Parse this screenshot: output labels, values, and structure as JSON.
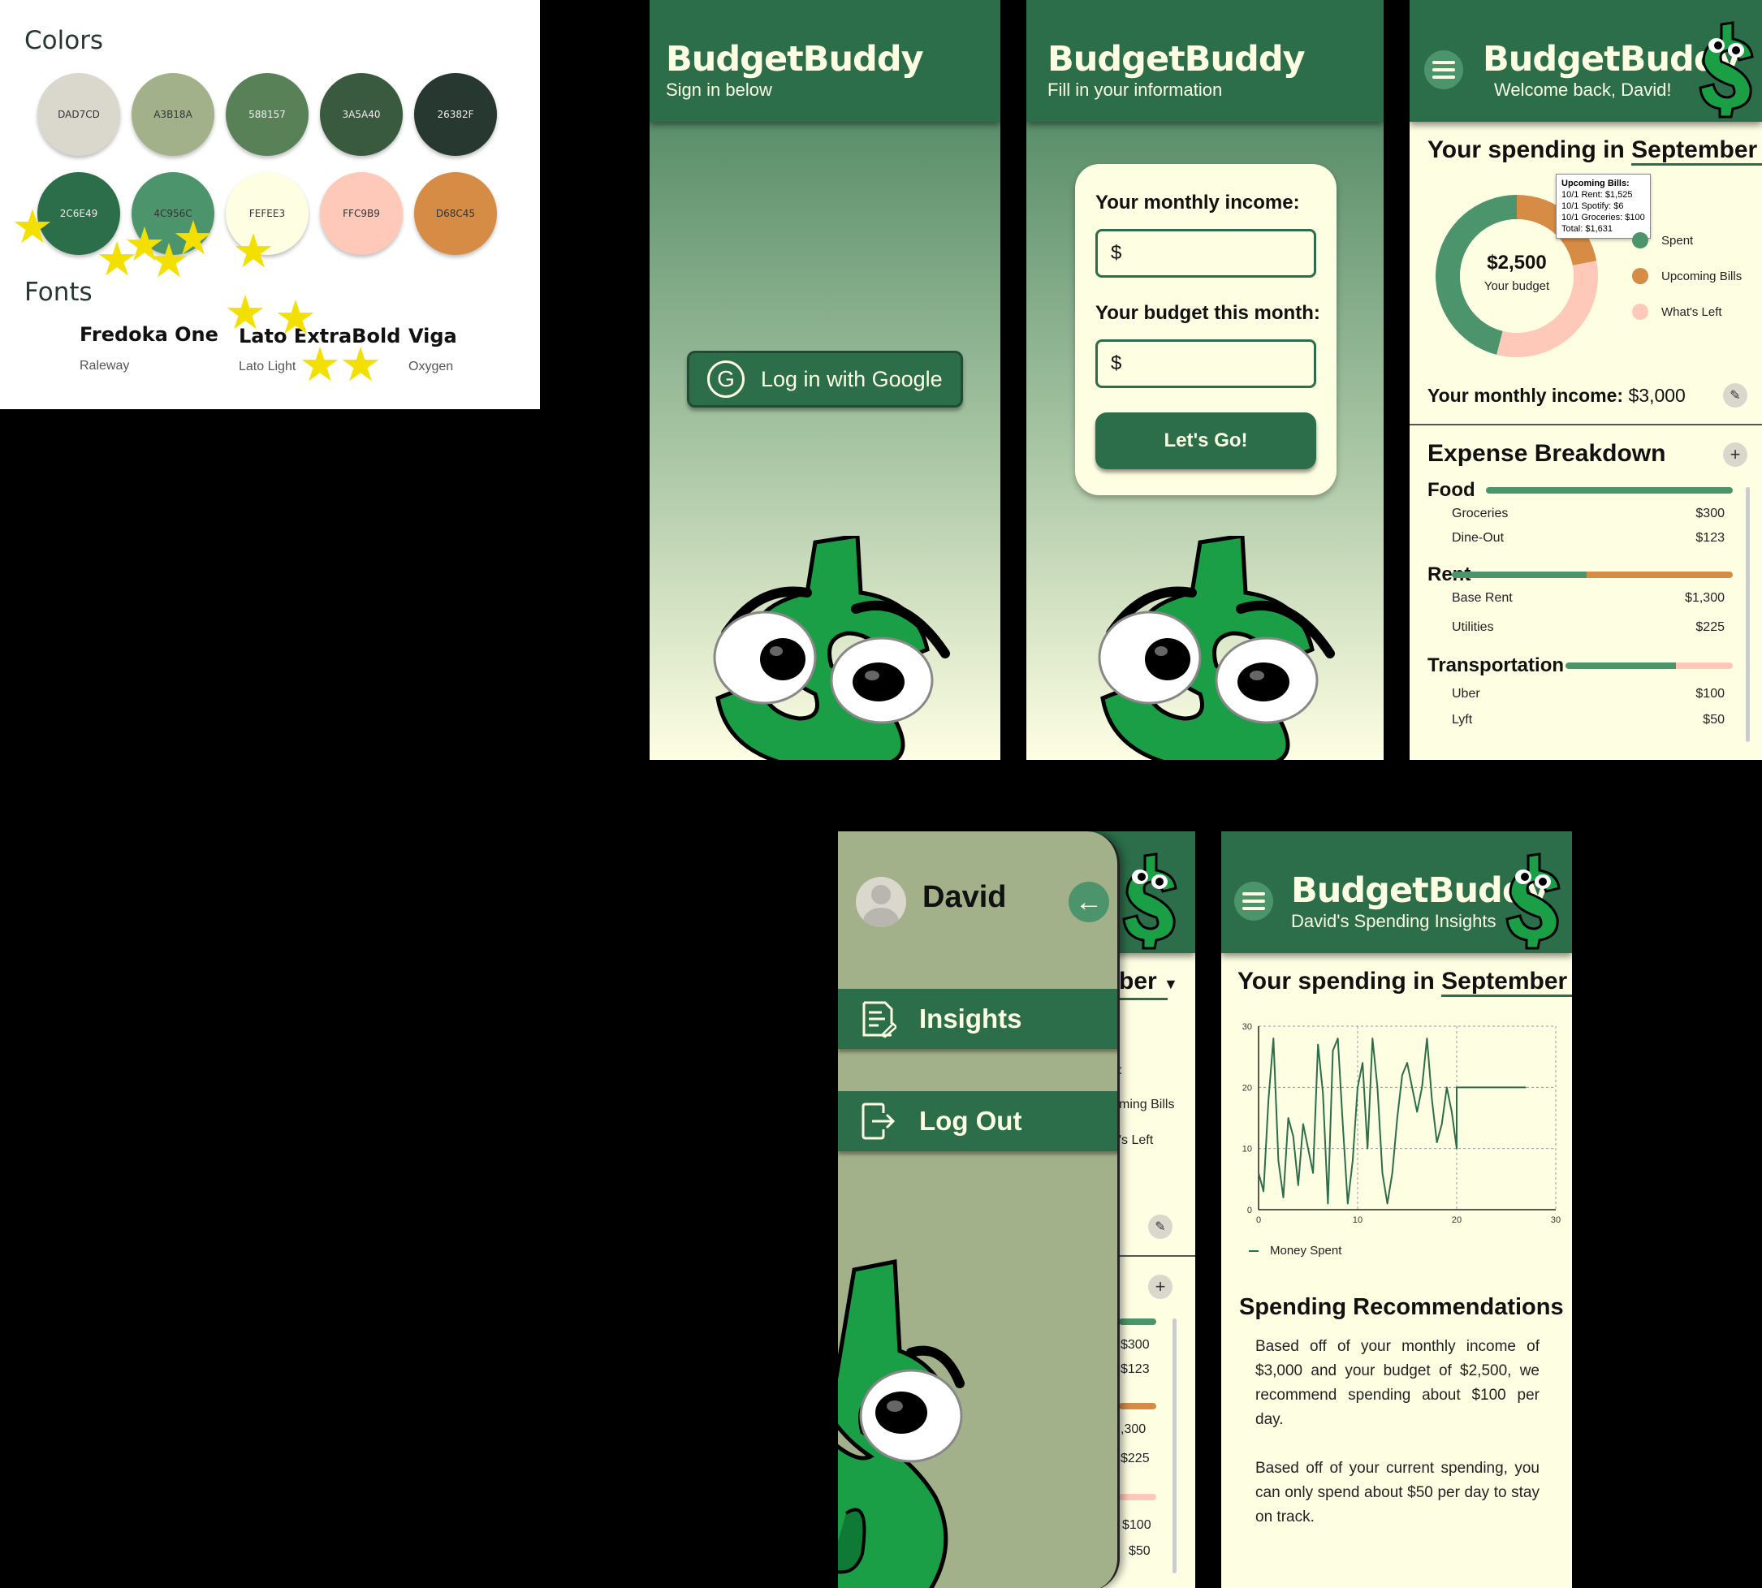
{
  "guide": {
    "colors_heading": "Colors",
    "fonts_heading": "Fonts",
    "swatches": [
      {
        "label": "DAD7CD",
        "hex": "#dad7cd"
      },
      {
        "label": "A3B18A",
        "hex": "#a3b18a"
      },
      {
        "label": "588157",
        "hex": "#588157"
      },
      {
        "label": "3A5A40",
        "hex": "#3a5a40"
      },
      {
        "label": "26382F",
        "hex": "#26382f"
      },
      {
        "label": "2C6E49",
        "hex": "#2c6e49"
      },
      {
        "label": "4C956C",
        "hex": "#4c956c"
      },
      {
        "label": "FEFEE3",
        "hex": "#fefee3"
      },
      {
        "label": "FFC9B9",
        "hex": "#ffc9b9"
      },
      {
        "label": "D68C45",
        "hex": "#d68c45"
      }
    ],
    "fonts": [
      {
        "name": "Fredoka One",
        "sub": "Raleway"
      },
      {
        "name": "Lato ExtraBold",
        "sub": "Lato Light"
      },
      {
        "name": "Viga",
        "sub": "Oxygen"
      }
    ]
  },
  "login": {
    "brand": "BudgetBuddy",
    "subtitle": "Sign in below",
    "google_button": "Log in with Google"
  },
  "info": {
    "brand": "BudgetBuddy",
    "subtitle": "Fill in your information",
    "income_label": "Your monthly income:",
    "income_value": "$",
    "budget_label": "Your budget this month:",
    "budget_value": "$",
    "go_button": "Let's Go!"
  },
  "dashboard": {
    "brand": "BudgetBuddy",
    "subtitle": "Welcome back, David!",
    "spending_prefix": "Your spending in",
    "month": "September",
    "budget_amount": "$2,500",
    "budget_label": "Your budget",
    "tooltip": {
      "title": "Upcoming Bills:",
      "lines": [
        "10/1 Rent: $1,525",
        "10/1 Spotify: $6",
        "10/1 Groceries: $100",
        "Total: $1,631"
      ]
    },
    "legend": [
      {
        "label": "Spent",
        "color": "#4c956c"
      },
      {
        "label": "Upcoming Bills",
        "color": "#d68c45"
      },
      {
        "label": "What's Left",
        "color": "#ffc9b9"
      }
    ],
    "donut_fractions": {
      "spent": 0.46,
      "upcoming": 0.22,
      "left": 0.32
    },
    "income_label": "Your monthly income:",
    "income_value": "$3,000",
    "expense_title": "Expense Breakdown",
    "categories": [
      {
        "name": "Food",
        "items": [
          {
            "label": "Groceries",
            "amount": "$300"
          },
          {
            "label": "Dine-Out",
            "amount": "$123"
          }
        ]
      },
      {
        "name": "Rent",
        "items": [
          {
            "label": "Base Rent",
            "amount": "$1,300"
          },
          {
            "label": "Utilities",
            "amount": "$225"
          }
        ]
      },
      {
        "name": "Transportation",
        "items": [
          {
            "label": "Uber",
            "amount": "$100"
          },
          {
            "label": "Lyft",
            "amount": "$50"
          }
        ]
      }
    ]
  },
  "menu": {
    "user": "David",
    "items": [
      "Insights",
      "Log Out"
    ],
    "behind": {
      "partial_title": "ber",
      "legend_upcoming": "ming Bills",
      "legend_left": "'s Left",
      "legend_stub": ":",
      "amounts": [
        "$300",
        "$123",
        ",300",
        "$225",
        "$100",
        "$50"
      ]
    }
  },
  "insights": {
    "brand": "BudgetBuddy",
    "subtitle": "David's Spending Insights",
    "spending_prefix": "Your spending in",
    "month": "September",
    "legend_label": "Money Spent",
    "rec_title": "Spending Recommendations",
    "rec_p1": "Based off of your monthly income of $3,000 and your budget of $2,500, we recommend spending about $100 per day.",
    "rec_p2": "Based off of your current spending, you can only spend about $50 per day to stay on track."
  },
  "chart_data": {
    "type": "line",
    "title": "",
    "xlabel": "",
    "ylabel": "",
    "xlim": [
      0,
      30
    ],
    "ylim": [
      0,
      30
    ],
    "xticks": [
      "0",
      "10",
      "20",
      "30"
    ],
    "yticks": [
      "0",
      "10",
      "20",
      "30"
    ],
    "grid": true,
    "legend_position": "bottom-left",
    "series": [
      {
        "name": "Money Spent",
        "color": "#2c6e49",
        "x": [
          0,
          0.5,
          1,
          1.5,
          2,
          2.5,
          3,
          3.5,
          4,
          4.5,
          5,
          5.5,
          6,
          6.5,
          7,
          7.5,
          8,
          8.5,
          9,
          9.5,
          10,
          10.5,
          11,
          11.5,
          12,
          12.5,
          13,
          13.5,
          14,
          14.5,
          15,
          15.5,
          16,
          16.5,
          17,
          17.5,
          18,
          18.5,
          19,
          19.5,
          20,
          20,
          21,
          22,
          23,
          24,
          25,
          26,
          27
        ],
        "y": [
          6,
          3,
          18,
          28,
          8,
          2,
          15,
          12,
          4,
          14,
          10,
          6,
          27,
          19,
          1,
          26,
          28,
          14,
          1,
          8,
          20,
          24,
          10,
          28,
          20,
          6,
          1,
          6,
          15,
          22,
          24,
          20,
          16,
          20,
          28,
          18,
          11,
          14,
          20,
          16,
          10,
          20,
          20,
          20,
          20,
          20,
          20,
          20,
          20
        ]
      }
    ]
  }
}
